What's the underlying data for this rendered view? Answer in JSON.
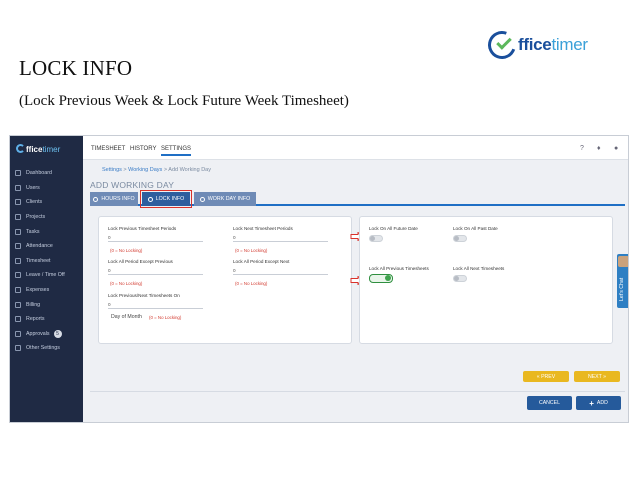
{
  "slide": {
    "title": "LOCK INFO",
    "subtitle": "(Lock Previous Week & Lock Future Week Timesheet)"
  },
  "logo": {
    "text_main": "ffice",
    "text_accent": "timer"
  },
  "app": {
    "sidebar_logo": {
      "main": "ffice",
      "accent": "timer"
    },
    "sidebar": {
      "items": [
        {
          "label": "Dashboard",
          "icon": "dashboard-icon"
        },
        {
          "label": "Users",
          "icon": "users-icon"
        },
        {
          "label": "Clients",
          "icon": "clients-icon"
        },
        {
          "label": "Projects",
          "icon": "projects-icon"
        },
        {
          "label": "Tasks",
          "icon": "tasks-icon"
        },
        {
          "label": "Attendance",
          "icon": "attendance-icon"
        },
        {
          "label": "Timesheet",
          "icon": "timesheet-icon"
        },
        {
          "label": "Leave / Time Off",
          "icon": "leave-icon"
        },
        {
          "label": "Expenses",
          "icon": "expenses-icon"
        },
        {
          "label": "Billing",
          "icon": "billing-icon"
        },
        {
          "label": "Reports",
          "icon": "reports-icon"
        },
        {
          "label": "Approvals",
          "icon": "approvals-icon",
          "badge": "5"
        },
        {
          "label": "Other Settings",
          "icon": "settings-icon"
        }
      ]
    },
    "topbar": {
      "tabs": [
        "TIMESHEET",
        "HISTORY",
        "SETTINGS"
      ],
      "active_tab": "SETTINGS",
      "icons": [
        "help-icon",
        "bell-icon",
        "user-icon"
      ]
    },
    "breadcrumb": {
      "a": "Settings",
      "sep": ">",
      "b": "Working Days",
      "c": "Add Working Day"
    },
    "page_title": "ADD WORKING DAY",
    "subtabs": [
      {
        "label": "HOURS INFO"
      },
      {
        "label": "LOCK INFO",
        "active": true
      },
      {
        "label": "WORK DAY INFO"
      }
    ],
    "left_panel": {
      "lock_prev_periods": {
        "label": "Lock Previous Timesheet Periods",
        "value": "0",
        "hint": "(0 = No Locking)"
      },
      "lock_next_periods": {
        "label": "Lock Next Timesheet Periods",
        "value": "0",
        "hint": "(0 = No Locking)"
      },
      "lock_all_except_prev": {
        "label": "Lock All Period Except Previous",
        "value": "0",
        "hint": "(0 = No Locking)"
      },
      "lock_all_except_next": {
        "label": "Lock All Period Except Next",
        "value": "0",
        "hint": "(0 = No Locking)"
      },
      "lock_prev_next_on": {
        "label": "Lock Previous/Next Timesheets On",
        "value": "0"
      },
      "day_of_month": {
        "label": "Day of Month",
        "hint": "(0 = No Locking)"
      }
    },
    "right_panel": {
      "lock_future_date": {
        "label": "Lock On All Future Date",
        "on": false
      },
      "lock_past_date": {
        "label": "Lock On All Past Date",
        "on": false
      },
      "lock_prev_timesheets": {
        "label": "Lock All Previous Timesheets",
        "on": true
      },
      "lock_next_timesheets": {
        "label": "Lock All Next Timesheets",
        "on": false
      }
    },
    "buttons": {
      "prev": "« PREV",
      "next": "NEXT »",
      "cancel": "CANCEL",
      "add": "ADD"
    },
    "chat": {
      "label": "Let's Chat"
    },
    "colors": {
      "sidebar": "#1f2a44",
      "accent": "#1f6fc5",
      "yellow": "#e9b820",
      "toggle_on": "#3fa34d",
      "hint_red": "#d23a2f"
    }
  }
}
